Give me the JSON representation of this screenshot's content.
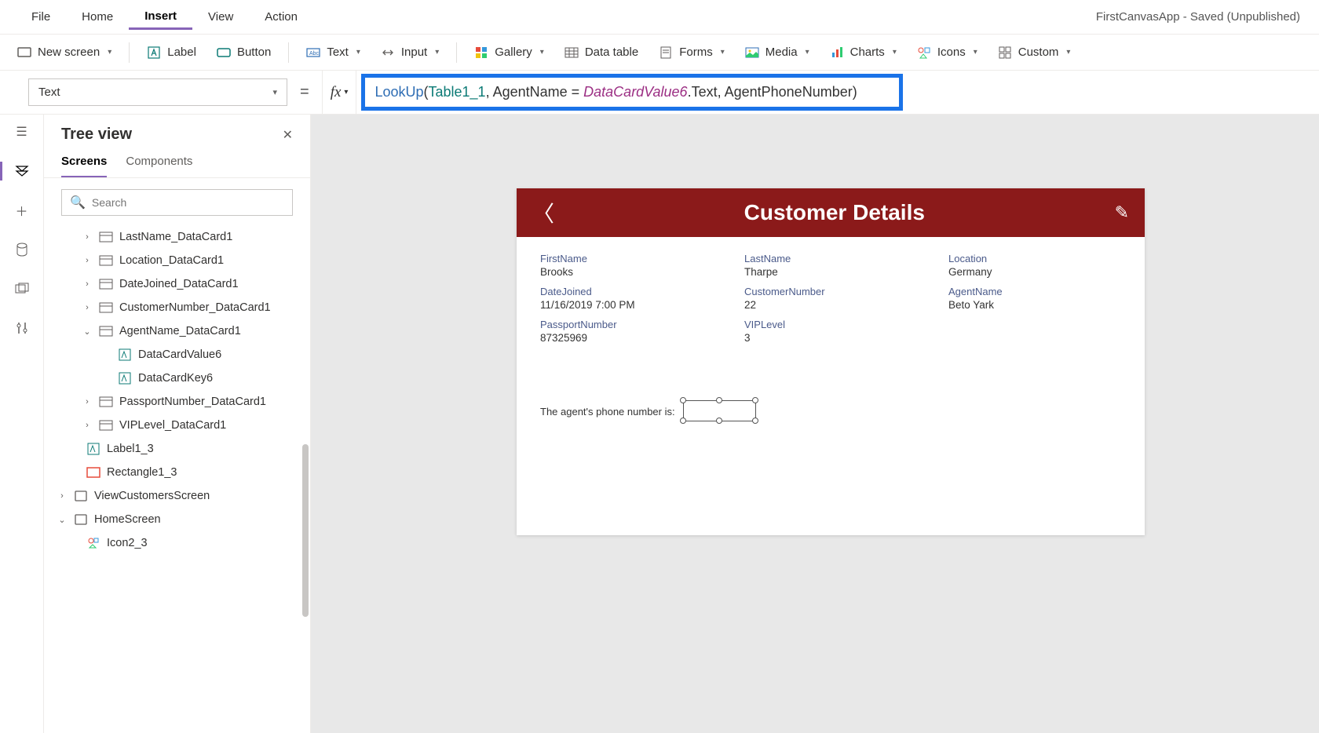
{
  "app_title": "FirstCanvasApp - Saved (Unpublished)",
  "menubar": {
    "file": "File",
    "home": "Home",
    "insert": "Insert",
    "view": "View",
    "action": "Action"
  },
  "toolbar": {
    "new_screen": "New screen",
    "label": "Label",
    "button": "Button",
    "text": "Text",
    "input": "Input",
    "gallery": "Gallery",
    "data_table": "Data table",
    "forms": "Forms",
    "media": "Media",
    "charts": "Charts",
    "icons": "Icons",
    "custom": "Custom"
  },
  "property_selected": "Text",
  "formula": {
    "fn": "LookUp",
    "tbl": "Table1_1",
    "arg1": "AgentName",
    "obj": "DataCardValue6",
    "prop": ".Text",
    "arg2": "AgentPhoneNumber"
  },
  "panel": {
    "title": "Tree view",
    "tabs": {
      "screens": "Screens",
      "components": "Components"
    },
    "search_placeholder": "Search"
  },
  "tree": {
    "items": [
      {
        "indent": 1,
        "caret": "›",
        "icon": "card",
        "label": "LastName_DataCard1"
      },
      {
        "indent": 1,
        "caret": "›",
        "icon": "card",
        "label": "Location_DataCard1"
      },
      {
        "indent": 1,
        "caret": "›",
        "icon": "card",
        "label": "DateJoined_DataCard1"
      },
      {
        "indent": 1,
        "caret": "›",
        "icon": "card",
        "label": "CustomerNumber_DataCard1"
      },
      {
        "indent": 1,
        "caret": "⌄",
        "icon": "card",
        "label": "AgentName_DataCard1"
      },
      {
        "indent": 2,
        "caret": "",
        "icon": "input",
        "label": "DataCardValue6"
      },
      {
        "indent": 2,
        "caret": "",
        "icon": "input",
        "label": "DataCardKey6"
      },
      {
        "indent": 1,
        "caret": "›",
        "icon": "card",
        "label": "PassportNumber_DataCard1"
      },
      {
        "indent": 1,
        "caret": "›",
        "icon": "card",
        "label": "VIPLevel_DataCard1"
      },
      {
        "indent": "0b",
        "caret": "",
        "icon": "input",
        "label": "Label1_3"
      },
      {
        "indent": "0b",
        "caret": "",
        "icon": "rect",
        "label": "Rectangle1_3"
      },
      {
        "indent": 0,
        "caret": "›",
        "icon": "screen",
        "label": "ViewCustomersScreen"
      },
      {
        "indent": 0,
        "caret": "⌄",
        "icon": "screen",
        "label": "HomeScreen"
      },
      {
        "indent": "0b",
        "caret": "",
        "icon": "iconctl",
        "label": "Icon2_3"
      }
    ]
  },
  "preview": {
    "title": "Customer Details",
    "fields": [
      {
        "lbl": "FirstName",
        "val": "Brooks"
      },
      {
        "lbl": "LastName",
        "val": "Tharpe"
      },
      {
        "lbl": "Location",
        "val": "Germany"
      },
      {
        "lbl": "DateJoined",
        "val": "11/16/2019 7:00 PM"
      },
      {
        "lbl": "CustomerNumber",
        "val": "22"
      },
      {
        "lbl": "AgentName",
        "val": "Beto Yark"
      },
      {
        "lbl": "PassportNumber",
        "val": "87325969"
      },
      {
        "lbl": "VIPLevel",
        "val": "3"
      }
    ],
    "agent_phone_label": "The agent's phone number is:"
  }
}
